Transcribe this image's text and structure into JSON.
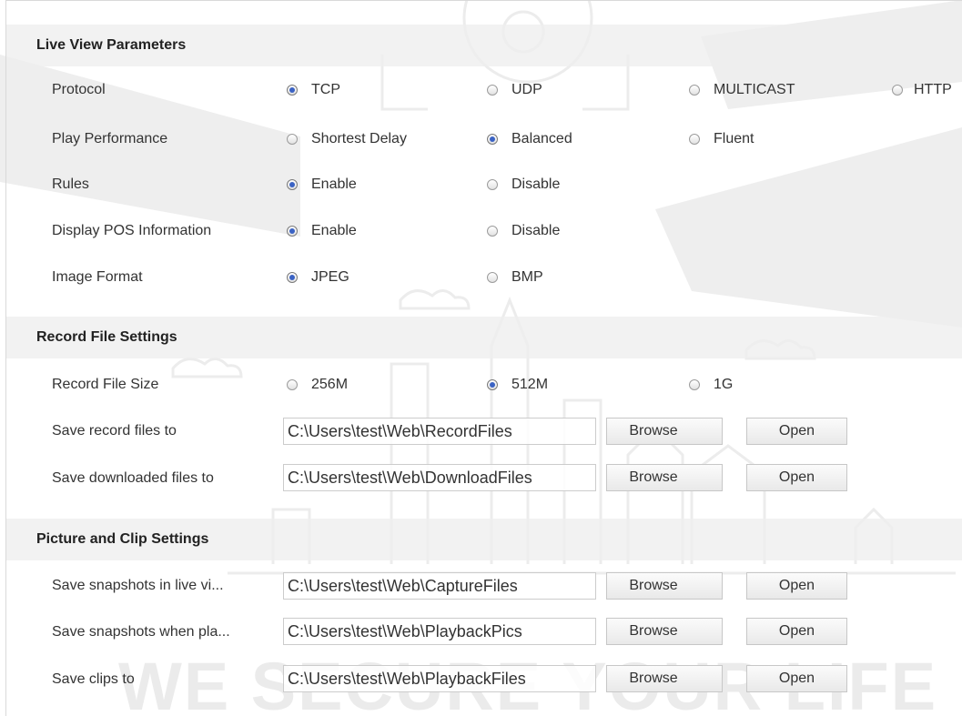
{
  "watermark": {
    "slogan": "WE SECURE YOUR LIFE"
  },
  "live_view": {
    "title": "Live View Parameters",
    "protocol": {
      "label": "Protocol",
      "options": [
        "TCP",
        "UDP",
        "MULTICAST",
        "HTTP"
      ],
      "selected": "TCP"
    },
    "play_performance": {
      "label": "Play Performance",
      "options": [
        "Shortest Delay",
        "Balanced",
        "Fluent"
      ],
      "selected": "Balanced"
    },
    "rules": {
      "label": "Rules",
      "options": [
        "Enable",
        "Disable"
      ],
      "selected": "Enable"
    },
    "pos_info": {
      "label": "Display POS Information",
      "options": [
        "Enable",
        "Disable"
      ],
      "selected": "Enable"
    },
    "image_format": {
      "label": "Image Format",
      "options": [
        "JPEG",
        "BMP"
      ],
      "selected": "JPEG"
    }
  },
  "record_file": {
    "title": "Record File Settings",
    "size": {
      "label": "Record File Size",
      "options": [
        "256M",
        "512M",
        "1G"
      ],
      "selected": "512M"
    },
    "save_record": {
      "label": "Save record files to",
      "value": "C:\\Users\\test\\Web\\RecordFiles"
    },
    "save_downloaded": {
      "label": "Save downloaded files to",
      "value": "C:\\Users\\test\\Web\\DownloadFiles"
    }
  },
  "picture_clip": {
    "title": "Picture and Clip Settings",
    "snap_live": {
      "label": "Save snapshots in live vi...",
      "value": "C:\\Users\\test\\Web\\CaptureFiles"
    },
    "snap_playback": {
      "label": "Save snapshots when pla...",
      "value": "C:\\Users\\test\\Web\\PlaybackPics"
    },
    "clips": {
      "label": "Save clips to",
      "value": "C:\\Users\\test\\Web\\PlaybackFiles"
    }
  },
  "buttons": {
    "browse": "Browse",
    "open": "Open"
  },
  "colors": {
    "section_bg": "#eeeeee",
    "radio_dot": "#3b63c4",
    "watermark": "#e6e6e6"
  }
}
